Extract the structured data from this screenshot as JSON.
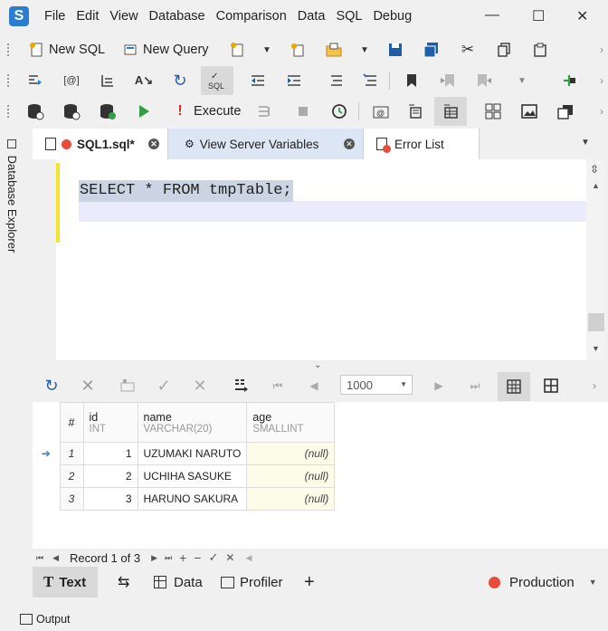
{
  "app": {
    "logo_letter": "S",
    "accent": "#2b7cd3"
  },
  "menu": [
    "File",
    "Edit",
    "View",
    "Database",
    "Comparison",
    "Data",
    "SQL",
    "Debug"
  ],
  "window_controls": {
    "minimize": "—",
    "maximize": "☐",
    "close": "✕"
  },
  "toolbar1": {
    "new_sql": "New SQL",
    "new_query": "New Query"
  },
  "toolbar3": {
    "execute": "Execute"
  },
  "sidebar": {
    "database_explorer": "Database Explorer"
  },
  "tabs": [
    {
      "label": "SQL1.sql*"
    },
    {
      "label": "View Server Variables"
    },
    {
      "label": "Error List"
    }
  ],
  "editor": {
    "sql": "SELECT * FROM tmpTable;"
  },
  "results_toolbar": {
    "row_limit": "1000"
  },
  "grid": {
    "columns": [
      {
        "header": "#",
        "type": ""
      },
      {
        "header": "id",
        "type": "INT"
      },
      {
        "header": "name",
        "type": "VARCHAR(20)"
      },
      {
        "header": "age",
        "type": "SMALLINT"
      }
    ],
    "rows": [
      {
        "rownum": "1",
        "id": "1",
        "name": "UZUMAKI NARUTO",
        "age": "(null)"
      },
      {
        "rownum": "2",
        "id": "2",
        "name": "UCHIHA SASUKE",
        "age": "(null)"
      },
      {
        "rownum": "3",
        "id": "3",
        "name": "HARUNO SAKURA",
        "age": "(null)"
      }
    ]
  },
  "record_nav": {
    "label": "Record 1 of 3"
  },
  "bottom_tabs": {
    "text": "Text",
    "data": "Data",
    "profiler": "Profiler",
    "add": "+",
    "connection": "Production",
    "connection_color": "#e74c3c"
  },
  "status": {
    "output": "Output"
  }
}
